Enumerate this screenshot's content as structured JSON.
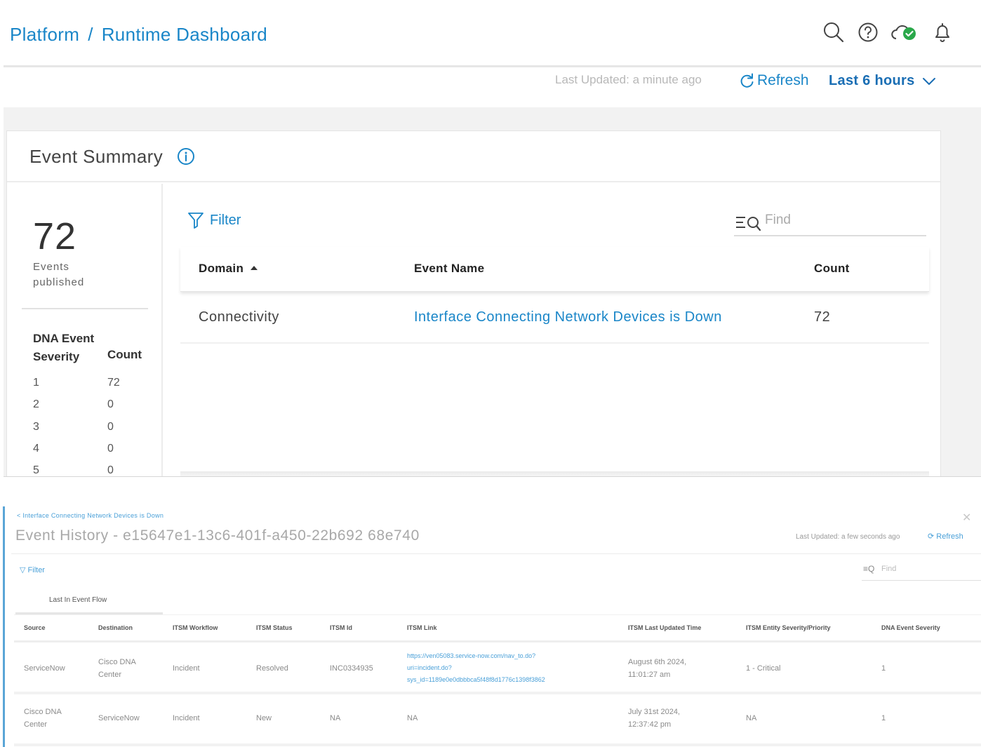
{
  "header": {
    "breadcrumb_root": "Platform",
    "breadcrumb_separator": "/",
    "breadcrumb_page": "Runtime Dashboard",
    "icons": [
      "search-icon",
      "help-icon",
      "cloud-status-icon",
      "notification-bell-icon"
    ],
    "status_color": "#2aa84a",
    "accent_color": "#1a86c8"
  },
  "toolbar": {
    "last_updated": "Last Updated: a minute ago",
    "refresh_label": "Refresh",
    "time_range": "Last 6 hours"
  },
  "summary": {
    "title": "Event Summary",
    "total": "72",
    "total_label": "Events published",
    "severity_header_1": "DNA Event",
    "severity_header_2": "Severity",
    "count_header": "Count",
    "severity_rows": [
      {
        "level": "1",
        "count": "72"
      },
      {
        "level": "2",
        "count": "0"
      },
      {
        "level": "3",
        "count": "0"
      },
      {
        "level": "4",
        "count": "0"
      },
      {
        "level": "5",
        "count": "0"
      }
    ],
    "filter_label": "Filter",
    "find_placeholder": "Find",
    "columns": {
      "domain": "Domain",
      "event_name": "Event Name",
      "count": "Count"
    },
    "rows": [
      {
        "domain": "Connectivity",
        "event_name": "Interface Connecting Network Devices is Down",
        "count": "72"
      }
    ]
  },
  "history": {
    "back_link": "< Interface Connecting Network Devices is Down",
    "title": "Event History - e15647e1-13c6-401f-a450-22b692 68e740",
    "last_updated": "Last Updated: a few seconds ago",
    "refresh_label": "Refresh",
    "filter_label": "Filter",
    "find_placeholder": "Find",
    "tab_label": "Last In Event Flow",
    "columns": [
      "Source",
      "Destination",
      "ITSM Workflow",
      "ITSM Status",
      "ITSM Id",
      "ITSM Link",
      "ITSM Last Updated Time",
      "ITSM Entity Severity/Priority",
      "DNA Event Severity"
    ],
    "rows": [
      {
        "source": "ServiceNow",
        "destination_1": "Cisco DNA",
        "destination_2": "Center",
        "workflow": "Incident",
        "status": "Resolved",
        "itsm_id": "INC0334935",
        "link_1": "https://ven05083.service-now.com/nav_to.do?",
        "link_2": "uri=incident.do?",
        "link_3": "sys_id=1189e0e0dbbbca5f48f8d1776c1398f3862",
        "updated_1": "August 6th 2024,",
        "updated_2": "11:01:27 am",
        "priority": "1 - Critical",
        "severity": "1"
      },
      {
        "source_1": "Cisco DNA",
        "source_2": "Center",
        "destination": "ServiceNow",
        "workflow": "Incident",
        "status": "New",
        "itsm_id": "NA",
        "link": "NA",
        "updated_1": "July 31st 2024,",
        "updated_2": "12:37:42 pm",
        "priority": "NA",
        "severity": "1"
      }
    ]
  }
}
